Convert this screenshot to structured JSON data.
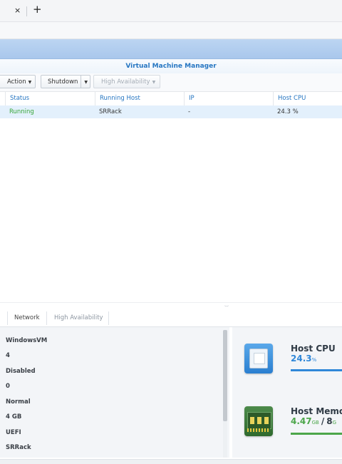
{
  "browser": {
    "close_glyph": "×",
    "new_tab_glyph": "+"
  },
  "window": {
    "title": "Virtual Machine Manager"
  },
  "toolbar": {
    "action_label": "Action",
    "shutdown_label": "Shutdown",
    "ha_label": "High Availability"
  },
  "table": {
    "headers": [
      "Status",
      "Running Host",
      "IP",
      "Host CPU"
    ],
    "rows": [
      {
        "status": "Running",
        "running_host": "SRRack",
        "ip": "-",
        "host_cpu": "24.3 %"
      }
    ]
  },
  "detail_tabs": {
    "network": "Network",
    "high_availability": "High Availability"
  },
  "properties": [
    "WindowsVM",
    "4",
    "Disabled",
    "0",
    "Normal",
    "4 GB",
    "UEFI",
    "SRRack"
  ],
  "stats": {
    "cpu": {
      "title": "Host CPU",
      "value": "24.3",
      "unit": "%"
    },
    "memory": {
      "title": "Host Memo",
      "used": "4.47",
      "used_unit": "GB",
      "slash": "/",
      "total": "8",
      "total_unit": "G"
    }
  },
  "colors": {
    "accent": "#2676c2",
    "running": "#38a639",
    "cpu": "#2f87d8",
    "memory": "#4ca64a"
  }
}
